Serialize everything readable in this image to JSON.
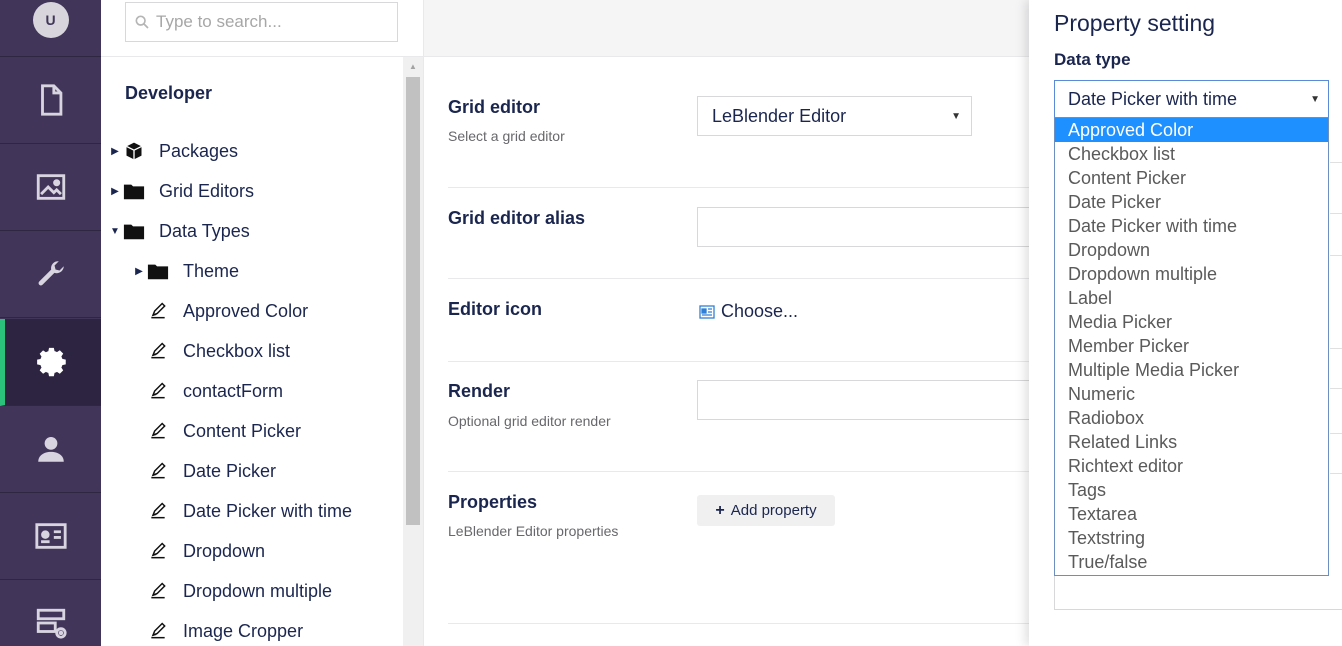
{
  "user": {
    "avatar_initial": "U"
  },
  "sections": [
    {
      "name": "content",
      "icon": "document-icon"
    },
    {
      "name": "media",
      "icon": "image-icon"
    },
    {
      "name": "settings",
      "icon": "wrench-icon"
    },
    {
      "name": "developer",
      "icon": "gear-icon",
      "active": true
    },
    {
      "name": "users",
      "icon": "user-icon"
    },
    {
      "name": "members",
      "icon": "id-card-icon"
    },
    {
      "name": "forms",
      "icon": "form-add-icon"
    }
  ],
  "search": {
    "placeholder": "Type to search..."
  },
  "tree": {
    "heading": "Developer",
    "items": [
      {
        "label": "Packages",
        "icon": "package-icon",
        "caret": "right"
      },
      {
        "label": "Grid Editors",
        "icon": "folder-icon",
        "caret": "right"
      },
      {
        "label": "Data Types",
        "icon": "folder-icon",
        "caret": "down"
      },
      {
        "label": "Theme",
        "icon": "folder-icon",
        "caret": "right"
      },
      {
        "label": "Approved Color",
        "icon": "edit-icon"
      },
      {
        "label": "Checkbox list",
        "icon": "edit-icon"
      },
      {
        "label": "contactForm",
        "icon": "edit-icon"
      },
      {
        "label": "Content Picker",
        "icon": "edit-icon"
      },
      {
        "label": "Date Picker",
        "icon": "edit-icon"
      },
      {
        "label": "Date Picker with time",
        "icon": "edit-icon"
      },
      {
        "label": "Dropdown",
        "icon": "edit-icon"
      },
      {
        "label": "Dropdown multiple",
        "icon": "edit-icon"
      },
      {
        "label": "Image Cropper",
        "icon": "edit-icon"
      }
    ]
  },
  "editor": {
    "grid_editor": {
      "label": "Grid editor",
      "description": "Select a grid editor",
      "value": "LeBlender Editor"
    },
    "alias": {
      "label": "Grid editor alias",
      "value": ""
    },
    "icon": {
      "label": "Editor icon",
      "choose_label": "Choose..."
    },
    "render": {
      "label": "Render",
      "description": "Optional grid editor render",
      "value": ""
    },
    "properties": {
      "label": "Properties",
      "description": "LeBlender Editor properties",
      "add_button": "Add property"
    }
  },
  "property_setting": {
    "title": "Property setting",
    "data_type_label": "Data type",
    "selected": "Date Picker with time",
    "highlighted": "Approved Color",
    "options": [
      "Approved Color",
      "Checkbox list",
      "Content Picker",
      "Date Picker",
      "Date Picker with time",
      "Dropdown",
      "Dropdown multiple",
      "Label",
      "Media Picker",
      "Member Picker",
      "Multiple Media Picker",
      "Numeric",
      "Radiobox",
      "Related Links",
      "Richtext editor",
      "Tags",
      "Textarea",
      "Textstring",
      "True/false"
    ]
  },
  "colors": {
    "rail_bg": "#413659",
    "active_accent": "#2bc37c",
    "highlight": "#1e90ff",
    "text_primary": "#1b264f"
  }
}
